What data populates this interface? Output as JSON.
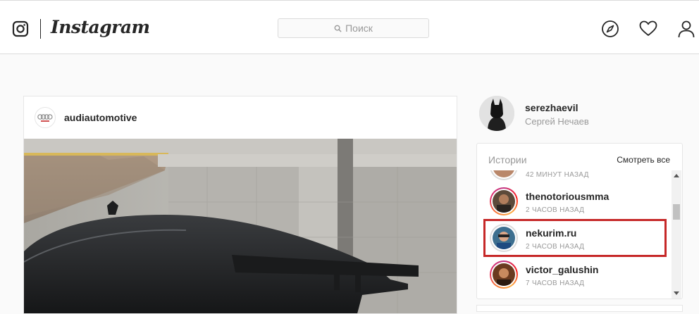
{
  "nav": {
    "wordmark": "Instagram",
    "search_placeholder": "Поиск"
  },
  "post": {
    "username": "audiautomotive"
  },
  "profile": {
    "username": "serezhaevil",
    "full_name": "Сергей Нечаев"
  },
  "stories": {
    "title": "Истории",
    "see_all": "Смотреть все",
    "items": [
      {
        "username": "",
        "time": "42 МИНУТ НАЗАД"
      },
      {
        "username": "thenotoriousmma",
        "time": "2 ЧАСОВ НАЗАД"
      },
      {
        "username": "nekurim.ru",
        "time": "2 ЧАСОВ НАЗАД"
      },
      {
        "username": "victor_galushin",
        "time": "7 ЧАСОВ НАЗАД"
      }
    ]
  },
  "colors": {
    "highlight": "#c62828",
    "border": "#dbdbdb",
    "secondary_text": "#999999"
  }
}
